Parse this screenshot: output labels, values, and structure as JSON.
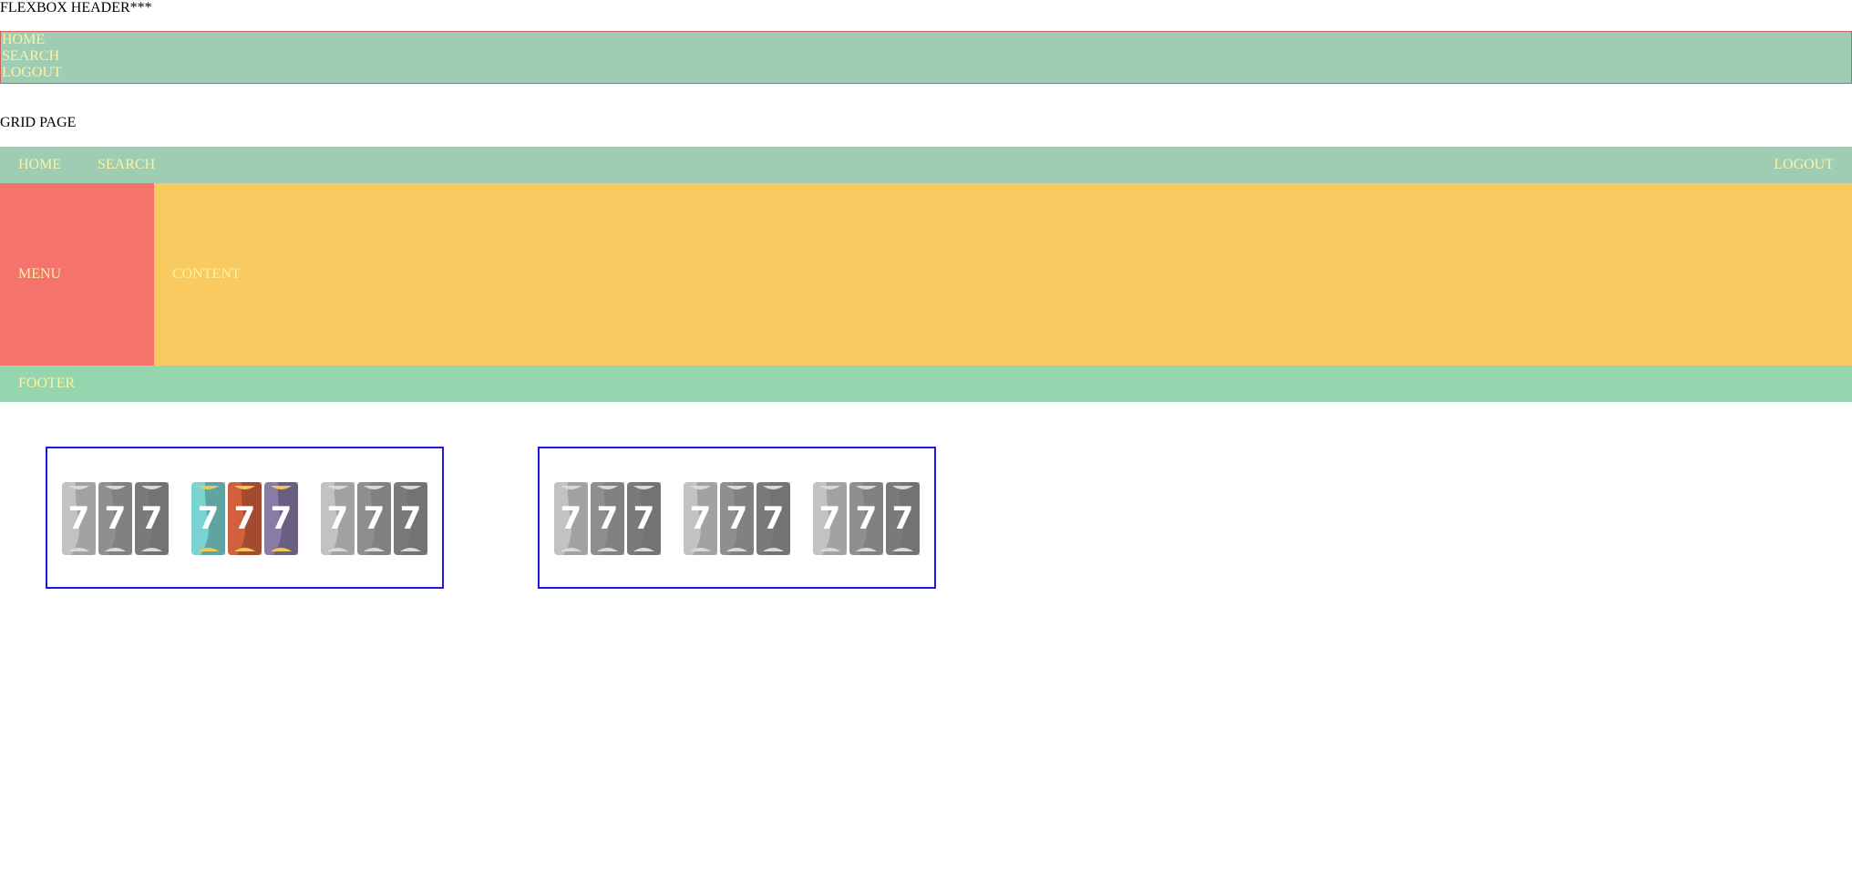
{
  "flex_section": {
    "title": "FLEXBOX HEADER***",
    "nav": [
      "HOME",
      "SEARCH",
      "LOGOUT"
    ]
  },
  "grid_section": {
    "title": "GRID PAGE",
    "nav": {
      "home": "HOME",
      "search": "SEARCH",
      "logout": "LOGOUT"
    },
    "menu": "MENU",
    "content": "CONTENT",
    "footer": "FOOTER"
  },
  "slots": {
    "reel_symbol": "7",
    "boxes": [
      {
        "groups": [
          {
            "state": "inactive",
            "reels": [
              "#c2c2c2",
              "#8f8f8f",
              "#7a7a7a"
            ]
          },
          {
            "state": "active",
            "reels": [
              "#7ad3d0",
              "#d0613c",
              "#8a7aa6"
            ]
          },
          {
            "state": "inactive",
            "reels": [
              "#c2c2c2",
              "#8f8f8f",
              "#7a7a7a"
            ]
          }
        ]
      },
      {
        "groups": [
          {
            "state": "inactive",
            "reels": [
              "#c2c2c2",
              "#8f8f8f",
              "#7a7a7a"
            ]
          },
          {
            "state": "inactive",
            "reels": [
              "#c2c2c2",
              "#8f8f8f",
              "#7a7a7a"
            ]
          },
          {
            "state": "inactive",
            "reels": [
              "#c2c2c2",
              "#8f8f8f",
              "#7a7a7a"
            ]
          }
        ]
      }
    ],
    "accent_colors": {
      "frame": "#2016df",
      "active_cap": "#f2c94c",
      "inactive_cap": "#d9d9d9",
      "inactive_shade": "#666666"
    }
  }
}
